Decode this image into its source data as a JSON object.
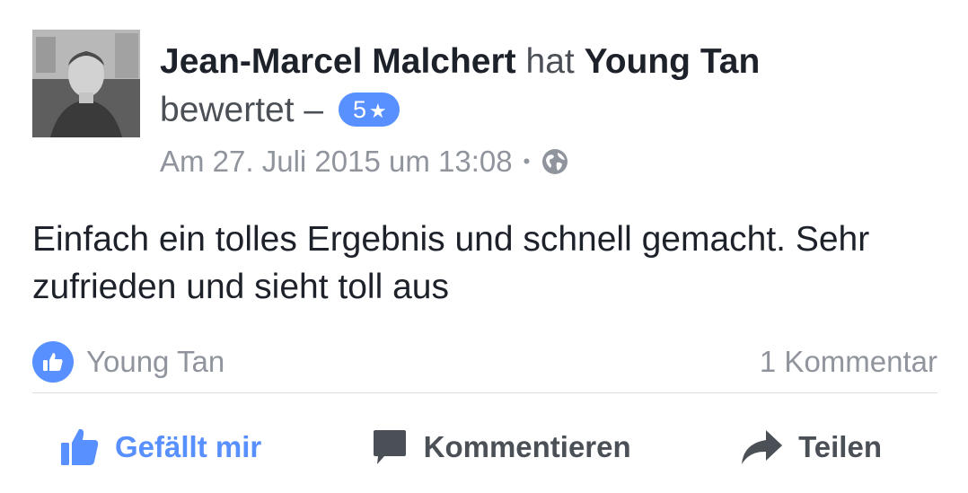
{
  "post": {
    "author": "Jean-Marcel Malchert",
    "verb": "hat",
    "target": "Young Tan",
    "rated_text": "bewertet –",
    "rating_value": "5",
    "rating_star": "★",
    "timestamp": "Am 27. Juli 2015 um 13:08",
    "dot": "•",
    "privacy_icon": "globe-icon",
    "body": "Einfach ein tolles Ergebnis und schnell gemacht. Sehr zufrieden und sieht toll aus"
  },
  "summary": {
    "liker": "Young Tan",
    "comments": "1 Kommentar"
  },
  "actions": {
    "like_label": "Gefällt mir",
    "comment_label": "Kommentieren",
    "share_label": "Teilen"
  },
  "colors": {
    "accent": "#5890ff",
    "text": "#1d2129",
    "muted": "#90949c",
    "action_text": "#4b4f56"
  }
}
